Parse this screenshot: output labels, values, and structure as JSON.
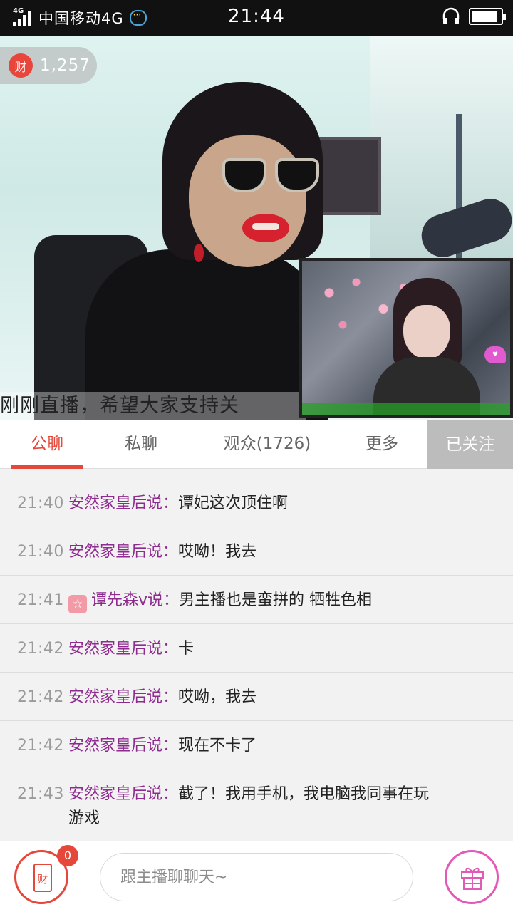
{
  "status_bar": {
    "network": "4G",
    "carrier": "中国移动4G",
    "time": "21:44"
  },
  "video": {
    "coin_badge": "财",
    "coin_count": "1,257",
    "caption": "刚刚直播，希望大家支持关"
  },
  "tabs": [
    {
      "label": "公聊"
    },
    {
      "label": "私聊"
    },
    {
      "label": "观众(1726)"
    },
    {
      "label": "更多"
    }
  ],
  "follow_label": "已关注",
  "messages": [
    {
      "time": "21:40",
      "user": "安然家皇后说：",
      "text": "谭妃这次顶住啊"
    },
    {
      "time": "21:40",
      "user": "安然家皇后说：",
      "text": "哎呦！我去"
    },
    {
      "time": "21:41",
      "user": "谭先森v说：",
      "text": "男主播也是蛮拼的 牺牲色相"
    },
    {
      "time": "21:42",
      "user": "安然家皇后说：",
      "text": "卡"
    },
    {
      "time": "21:42",
      "user": "安然家皇后说：",
      "text": "哎呦，我去"
    },
    {
      "time": "21:42",
      "user": "安然家皇后说：",
      "text": "现在不卡了"
    },
    {
      "time": "21:43",
      "user": "安然家皇后说：",
      "text": "截了！我用手机，我电脑我同事在玩",
      "text2": "游戏"
    }
  ],
  "bottom_bar": {
    "red_packet_label": "财",
    "red_packet_count": "0",
    "input_placeholder": "跟主播聊聊天~"
  },
  "colors": {
    "accent": "#e5483a",
    "username": "#8e2b8f",
    "follow_bg": "#bcbcbc",
    "gift": "#e25ab6"
  }
}
